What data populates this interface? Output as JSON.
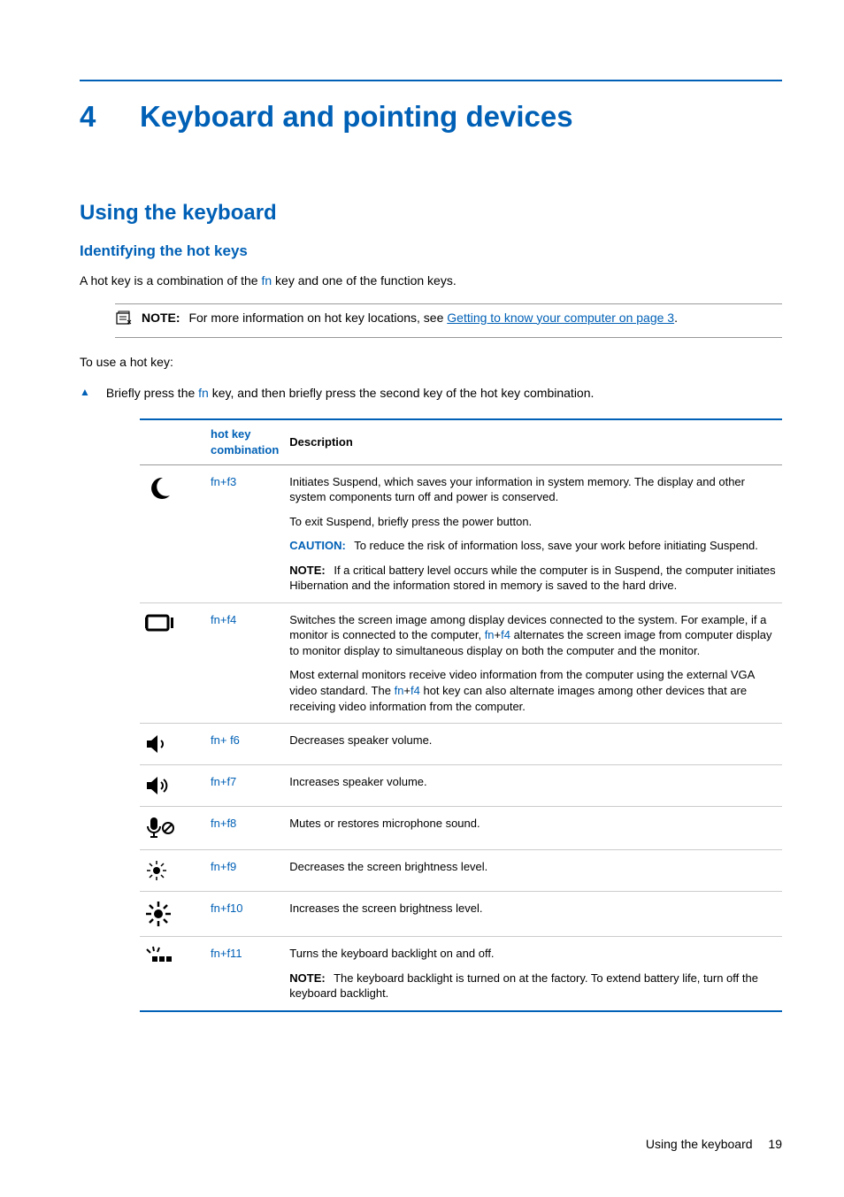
{
  "chapter": {
    "number": "4",
    "title": "Keyboard and pointing devices"
  },
  "section": "Using the keyboard",
  "subsection": "Identifying the hot keys",
  "intro_pre": "A hot key is a combination of the ",
  "intro_fn": "fn",
  "intro_post": " key and one of the function keys.",
  "note1": {
    "label": "NOTE:",
    "pre": "For more information on hot key locations, see ",
    "link": "Getting to know your computer on page 3",
    "post": "."
  },
  "to_use": "To use a hot key:",
  "bullet_pre": "Briefly press the ",
  "bullet_fn": "fn",
  "bullet_post": " key, and then briefly press the second key of the hot key combination.",
  "table": {
    "headers": {
      "combo": "hot key combination",
      "desc": "Description"
    },
    "rows": [
      {
        "icon": "moon",
        "key_pre": "fn",
        "key_plus": "+",
        "key_post": "f3",
        "html": "<p class='desc-para'>Initiates Suspend, which saves your information in system memory. The display and other system components turn off and power is conserved.</p><p class='desc-para'>To exit Suspend, briefly press the power button.</p><p class='desc-para'><span class='caution-label'>CAUTION:</span> To reduce the risk of information loss, save your work before initiating Suspend.</p><p class='desc-para'><span class='note-label'>NOTE:</span> If a critical battery level occurs while the computer is in Suspend, the computer initiates Hibernation and the information stored in memory is saved to the hard drive.</p>"
      },
      {
        "icon": "display",
        "key_pre": "fn",
        "key_plus": "+",
        "key_post": "f4",
        "html": "<p class='desc-para'>Switches the screen image among display devices connected to the system. For example, if a monitor is connected to the computer, <span class='fn'>fn</span>+<span class='fn'>f4</span> alternates the screen image from computer display to monitor display to simultaneous display on both the computer and the monitor.</p><p class='desc-para'>Most external monitors receive video information from the computer using the external VGA video standard. The <span class='fn'>fn</span>+<span class='fn'>f4</span> hot key can also alternate images among other devices that are receiving video information from the computer.</p>"
      },
      {
        "icon": "vol-down",
        "key_pre": "fn",
        "key_plus": "+ ",
        "key_post": "f6",
        "html": "<p class='desc-para'>Decreases speaker volume.</p>"
      },
      {
        "icon": "vol-up",
        "key_pre": "fn",
        "key_plus": "+",
        "key_post": "f7",
        "html": "<p class='desc-para'>Increases speaker volume.</p>"
      },
      {
        "icon": "mic-mute",
        "key_pre": "fn",
        "key_plus": "+",
        "key_post": "f8",
        "html": "<p class='desc-para'>Mutes or restores microphone sound.</p>"
      },
      {
        "icon": "bright-down",
        "key_pre": "fn",
        "key_plus": "+",
        "key_post": "f9",
        "html": "<p class='desc-para'>Decreases the screen brightness level.</p>"
      },
      {
        "icon": "bright-up",
        "key_pre": "fn",
        "key_plus": "+",
        "key_post": "f10",
        "html": "<p class='desc-para'>Increases the screen brightness level.</p>"
      },
      {
        "icon": "backlight",
        "key_pre": "fn",
        "key_plus": "+",
        "key_post": "f11",
        "html": "<p class='desc-para'>Turns the keyboard backlight on and off.</p><p class='desc-para'><span class='note-label'>NOTE:</span> The keyboard backlight is turned on at the factory. To extend battery life, turn off the keyboard backlight.</p>"
      }
    ]
  },
  "footer": {
    "text": "Using the keyboard",
    "page": "19"
  }
}
